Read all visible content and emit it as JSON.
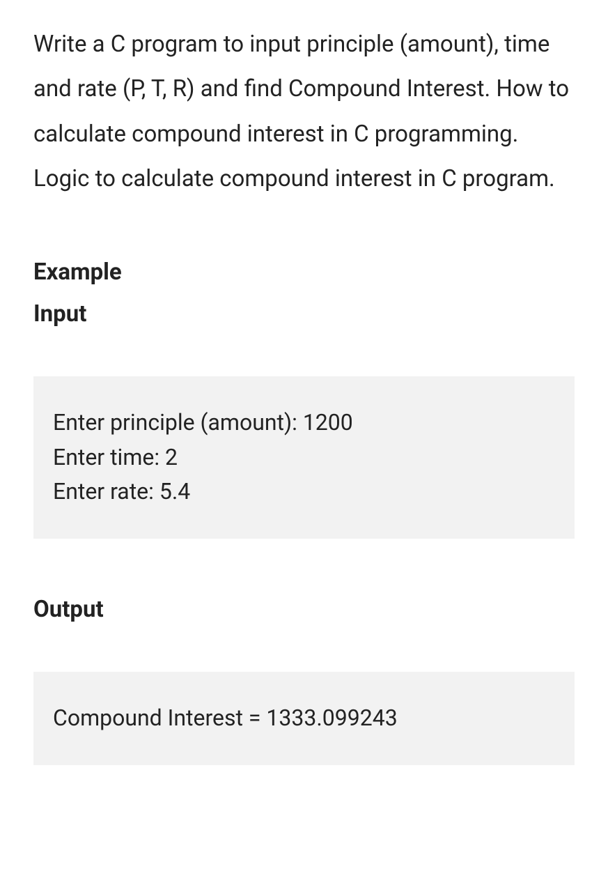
{
  "description": "Write a C program to input principle (amount), time and rate (P, T, R) and find Compound Interest. How to calculate compound interest in C programming. Logic to calculate compound interest in C program.",
  "headings": {
    "example": "Example",
    "input": "Input",
    "output": "Output"
  },
  "input_block": "Enter principle (amount): 1200\nEnter time: 2\nEnter rate: 5.4",
  "output_block": "Compound Interest = 1333.099243"
}
